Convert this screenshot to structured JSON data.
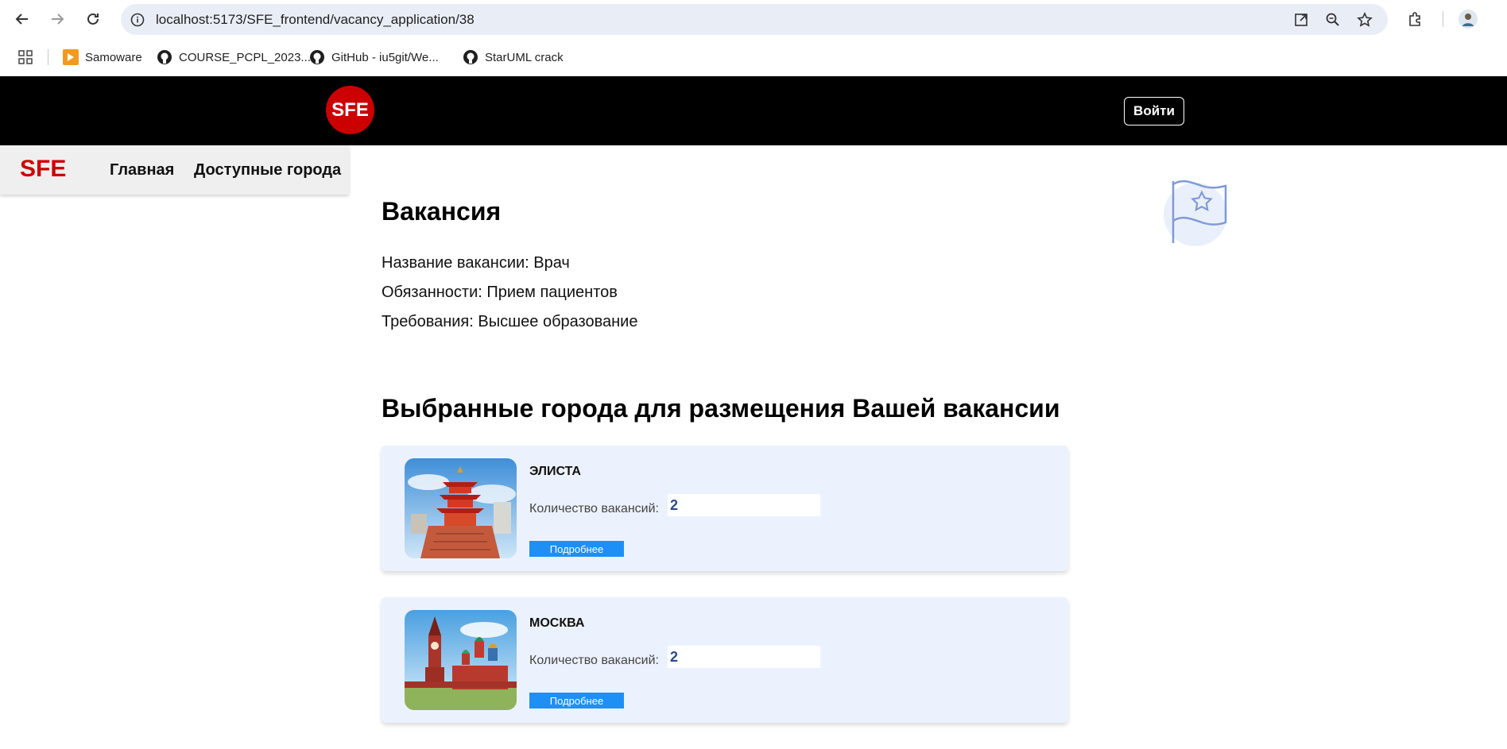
{
  "browser": {
    "url": "localhost:5173/SFE_frontend/vacancy_application/38",
    "bookmarks": [
      {
        "label": "Samoware",
        "icon": "samoware-icon"
      },
      {
        "label": "COURSE_PCPL_2023...",
        "icon": "github-icon"
      },
      {
        "label": "GitHub - iu5git/We...",
        "icon": "github-icon"
      },
      {
        "label": "StarUML crack",
        "icon": "github-icon"
      }
    ]
  },
  "header": {
    "logo_text": "SFE",
    "login_label": "Войти"
  },
  "sidebar": {
    "brand": "SFE",
    "links": [
      "Главная",
      "Доступные города"
    ]
  },
  "vacancy": {
    "title": "Вакансия",
    "name_line": "Название вакансии: Врач",
    "duties_line": "Обязанности: Прием пациентов",
    "requirements_line": "Требования: Высшее образование"
  },
  "cities_section": {
    "title": "Выбранные города для размещения Вашей вакансии",
    "cards": [
      {
        "name": "ЭЛИСТА",
        "qty_label": "Количество вакансий:",
        "qty_value": "2",
        "button_label": "Подробнее"
      },
      {
        "name": "МОСКВА",
        "qty_label": "Количество вакансий:",
        "qty_value": "2",
        "button_label": "Подробнее"
      }
    ]
  },
  "colors": {
    "brand_red": "#cc0000",
    "header_bg": "#000000",
    "card_bg": "#ecf2fd",
    "button_blue": "#1e8ff5"
  }
}
